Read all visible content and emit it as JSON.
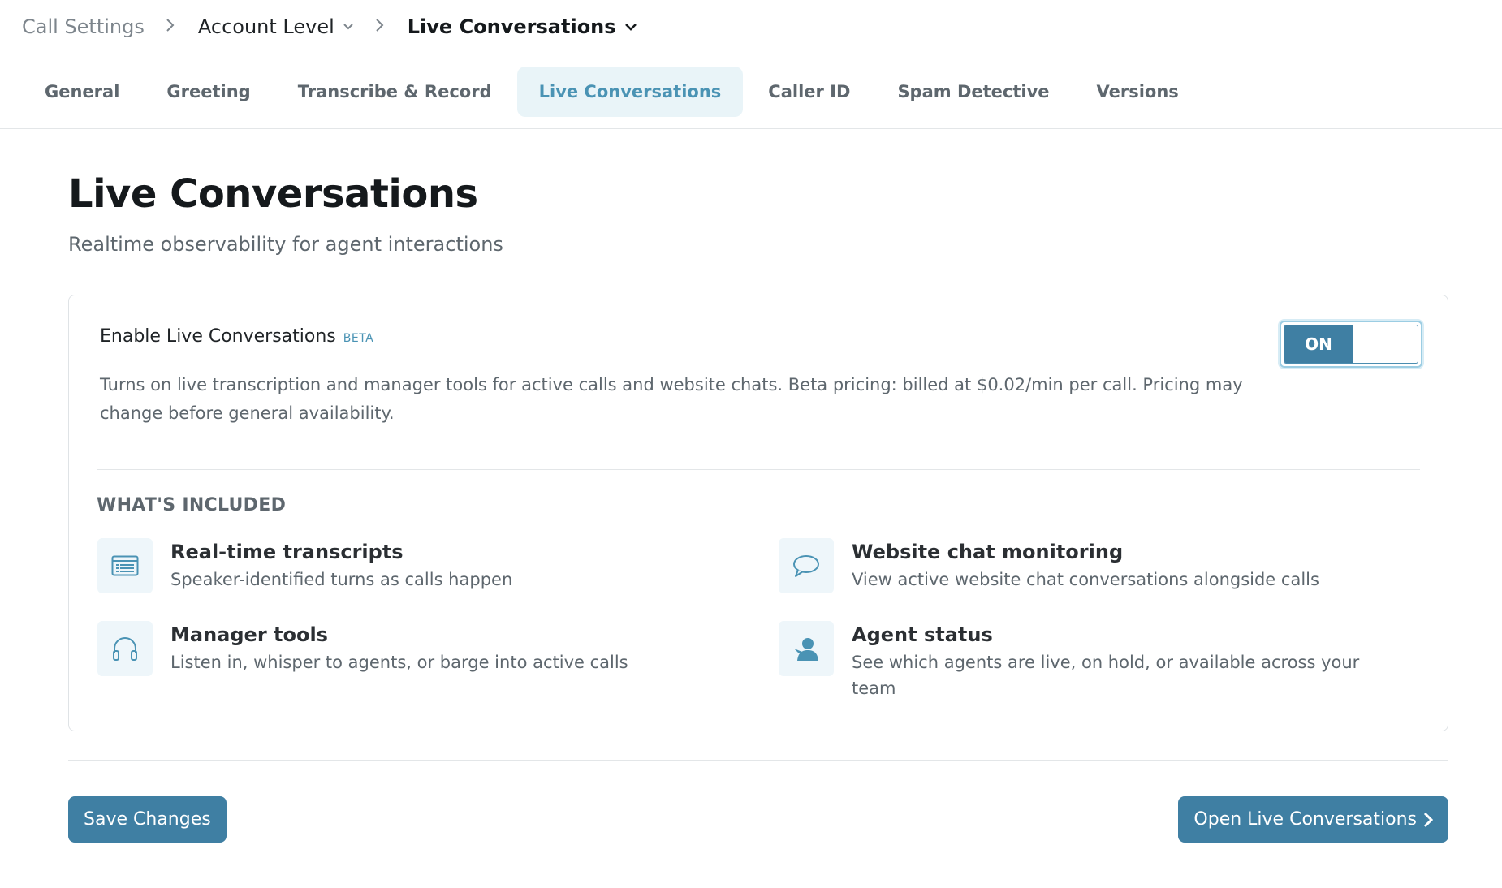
{
  "breadcrumb": {
    "root": "Call Settings",
    "level": "Account Level",
    "current": "Live Conversations"
  },
  "tabs": [
    {
      "label": "General",
      "active": false
    },
    {
      "label": "Greeting",
      "active": false
    },
    {
      "label": "Transcribe & Record",
      "active": false
    },
    {
      "label": "Live Conversations",
      "active": true
    },
    {
      "label": "Caller ID",
      "active": false
    },
    {
      "label": "Spam Detective",
      "active": false
    },
    {
      "label": "Versions",
      "active": false
    }
  ],
  "page": {
    "title": "Live Conversations",
    "subtitle": "Realtime observability for agent interactions"
  },
  "card": {
    "enable_label": "Enable Live Conversations",
    "beta_badge": "BETA",
    "description": "Turns on live transcription and manager tools for active calls and website chats. Beta pricing: billed at $0.02/min per call. Pricing may change before general availability.",
    "toggle": {
      "label": "ON",
      "state": "on"
    },
    "included_title": "WHAT'S INCLUDED",
    "features": [
      {
        "icon": "transcript-icon",
        "title": "Real-time transcripts",
        "desc": "Speaker-identified turns as calls happen"
      },
      {
        "icon": "chat-bubble-icon",
        "title": "Website chat monitoring",
        "desc": "View active website chat conversations alongside calls"
      },
      {
        "icon": "headphones-icon",
        "title": "Manager tools",
        "desc": "Listen in, whisper to agents, or barge into active calls"
      },
      {
        "icon": "agent-user-icon",
        "title": "Agent status",
        "desc": "See which agents are live, on hold, or available across your team"
      }
    ]
  },
  "actions": {
    "save_label": "Save Changes",
    "open_label": "Open Live Conversations"
  },
  "colors": {
    "accent": "#3f7fa3",
    "active_tab_bg": "#e9f4f8",
    "active_tab_text": "#4a93b4"
  }
}
